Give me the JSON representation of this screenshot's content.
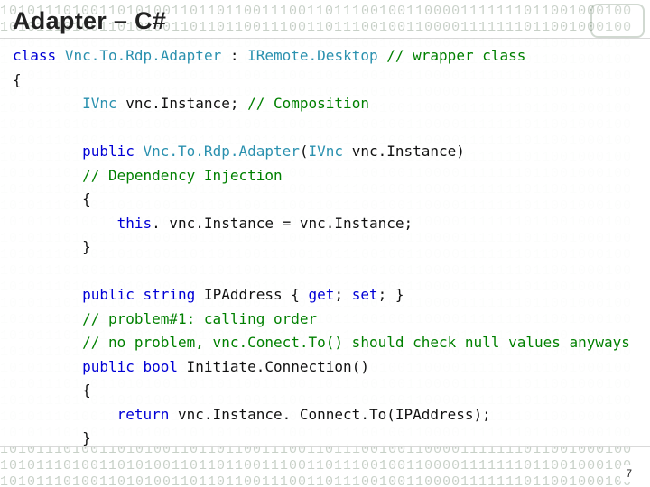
{
  "slide": {
    "title": "Adapter – C#",
    "page_number": "7",
    "binary_row": "1010111010011010100110110110011100110111001001100001111111011001000100",
    "colors": {
      "keyword": "#0000d6",
      "type": "#2b91af",
      "comment": "#008000",
      "text": "#111111"
    }
  },
  "code": {
    "t01a": "class",
    "t01b": "Vnc.To.Rdp.Adapter",
    "t01c": "IRemote.Desktop",
    "t01d": "// wrapper class",
    "t02": "{",
    "t03a": "IVnc",
    "t03b": " vnc.Instance; ",
    "t03c": "// Composition",
    "t05a": "public",
    "t05b": "Vnc.To.Rdp.Adapter",
    "t05c": "IVnc",
    "t05d": " vnc.Instance)",
    "t06": "// Dependency Injection",
    "t07": "{",
    "t08a": "this",
    "t08b": ". vnc.Instance = vnc.Instance;",
    "t09": "}",
    "t11a": "public",
    "t11b": "string",
    "t11c": " IPAddress { ",
    "t11d": "get",
    "t11e": "set",
    "t11f": "; }",
    "t12": "// problem#1: calling order",
    "t13": "// no problem, vnc.Conect.To() should check null values anyways",
    "t14a": "public",
    "t14b": "bool",
    "t14c": " Initiate.Connection()",
    "t15": "{",
    "t16a": "return",
    "t16b": " vnc.Instance. Connect.To(IPAddress);",
    "t17": "}"
  }
}
